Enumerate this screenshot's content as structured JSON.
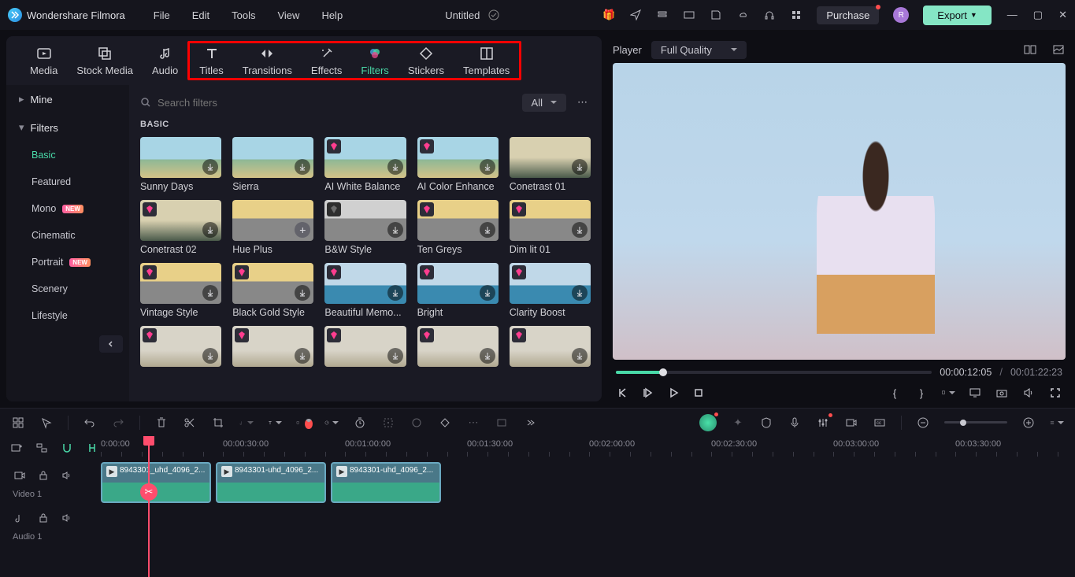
{
  "app": {
    "name": "Wondershare Filmora"
  },
  "menu": [
    "File",
    "Edit",
    "Tools",
    "View",
    "Help"
  ],
  "document": {
    "title": "Untitled"
  },
  "header_buttons": {
    "purchase": "Purchase",
    "export": "Export",
    "avatar_initial": "R"
  },
  "tabs": {
    "media": "Media",
    "stock_media": "Stock Media",
    "audio": "Audio",
    "titles": "Titles",
    "transitions": "Transitions",
    "effects": "Effects",
    "filters": "Filters",
    "stickers": "Stickers",
    "templates": "Templates"
  },
  "sidebar": {
    "mine": "Mine",
    "filters": "Filters",
    "items": [
      {
        "label": "Basic",
        "active": true
      },
      {
        "label": "Featured"
      },
      {
        "label": "Mono",
        "badge": "NEW"
      },
      {
        "label": "Cinematic"
      },
      {
        "label": "Portrait",
        "badge": "NEW"
      },
      {
        "label": "Scenery"
      },
      {
        "label": "Lifestyle"
      }
    ]
  },
  "search": {
    "placeholder": "Search filters",
    "all_label": "All"
  },
  "section_label": "BASIC",
  "filters_grid": [
    {
      "name": "Sunny Days",
      "premium": false,
      "thumb": "beach"
    },
    {
      "name": "Sierra",
      "premium": false,
      "thumb": "beach"
    },
    {
      "name": "AI White Balance",
      "premium": true,
      "thumb": "beach"
    },
    {
      "name": "AI Color Enhance",
      "premium": true,
      "thumb": "beach"
    },
    {
      "name": "Conetrast 01",
      "premium": false,
      "thumb": "cone"
    },
    {
      "name": "Conetrast 02",
      "premium": true,
      "thumb": "cone"
    },
    {
      "name": "Hue Plus",
      "premium": false,
      "thumb": "truck",
      "plus": true
    },
    {
      "name": "B&W Style",
      "premium": true,
      "thumb": "truckbw"
    },
    {
      "name": "Ten Greys",
      "premium": true,
      "thumb": "truck"
    },
    {
      "name": "Dim lit 01",
      "premium": true,
      "thumb": "truck"
    },
    {
      "name": "Vintage Style",
      "premium": true,
      "thumb": "truck"
    },
    {
      "name": "Black Gold Style",
      "premium": true,
      "thumb": "truck"
    },
    {
      "name": "Beautiful Memo...",
      "premium": true,
      "thumb": "sail"
    },
    {
      "name": "Bright",
      "premium": true,
      "thumb": "sail"
    },
    {
      "name": "Clarity Boost",
      "premium": true,
      "thumb": "sail"
    },
    {
      "name": "",
      "premium": true,
      "thumb": "light"
    },
    {
      "name": "",
      "premium": true,
      "thumb": "light"
    },
    {
      "name": "",
      "premium": true,
      "thumb": "light"
    },
    {
      "name": "",
      "premium": true,
      "thumb": "light"
    },
    {
      "name": "",
      "premium": true,
      "thumb": "light"
    }
  ],
  "player": {
    "label": "Player",
    "quality": "Full Quality",
    "current_time": "00:00:12:05",
    "total_time": "00:01:22:23"
  },
  "timeline": {
    "marks": [
      "0:00:00",
      "00:00:30:00",
      "00:01:00:00",
      "00:01:30:00",
      "00:02:00:00",
      "00:02:30:00",
      "00:03:00:00",
      "00:03:30:00"
    ],
    "video_track_label": "Video 1",
    "audio_track_label": "Audio 1",
    "clips": [
      {
        "name": "8943301_uhd_4096_2..."
      },
      {
        "name": "8943301-uhd_4096_2..."
      },
      {
        "name": "8943301-uhd_4096_2..."
      }
    ]
  }
}
